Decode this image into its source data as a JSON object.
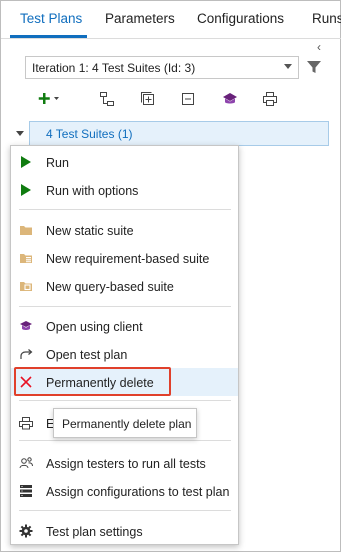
{
  "tabs": [
    {
      "label": "Test Plans",
      "active": true
    },
    {
      "label": "Parameters",
      "active": false
    },
    {
      "label": "Configurations",
      "active": false
    },
    {
      "label": "Runs",
      "active": false
    }
  ],
  "iteration_select": {
    "value": "Iteration 1: 4 Test Suites (Id: 3)"
  },
  "toolbar": {
    "icons": [
      "add-icon",
      "new-suite-hierarchy-icon",
      "expand-all-icon",
      "collapse-all-icon",
      "open-client-icon",
      "print-icon"
    ]
  },
  "tree": {
    "root_label": "4 Test Suites (1)"
  },
  "context_menu": {
    "items": [
      {
        "label": "Run",
        "icon": "play-icon"
      },
      {
        "label": "Run with options",
        "icon": "play-icon"
      },
      {
        "label": "New static suite",
        "icon": "folder-icon"
      },
      {
        "label": "New requirement-based suite",
        "icon": "requirement-suite-icon"
      },
      {
        "label": "New query-based suite",
        "icon": "query-suite-icon"
      },
      {
        "label": "Open using client",
        "icon": "visual-studio-icon"
      },
      {
        "label": "Open test plan",
        "icon": "redirect-arrow-icon"
      },
      {
        "label": "Permanently delete",
        "icon": "delete-x-icon"
      },
      {
        "label": "Ex",
        "icon": "export-icon"
      },
      {
        "label": "Assign testers to run all tests",
        "icon": "assign-testers-icon"
      },
      {
        "label": "Assign configurations to test plan",
        "icon": "configurations-icon"
      },
      {
        "label": "Test plan settings",
        "icon": "gear-icon"
      }
    ]
  },
  "tooltip": {
    "text": "Permanently delete plan"
  },
  "colors": {
    "accent": "#106ebe",
    "play_green": "#107c10",
    "delete_red": "#e81123",
    "highlight_border": "#e0402b",
    "vs_purple": "#68217a"
  }
}
